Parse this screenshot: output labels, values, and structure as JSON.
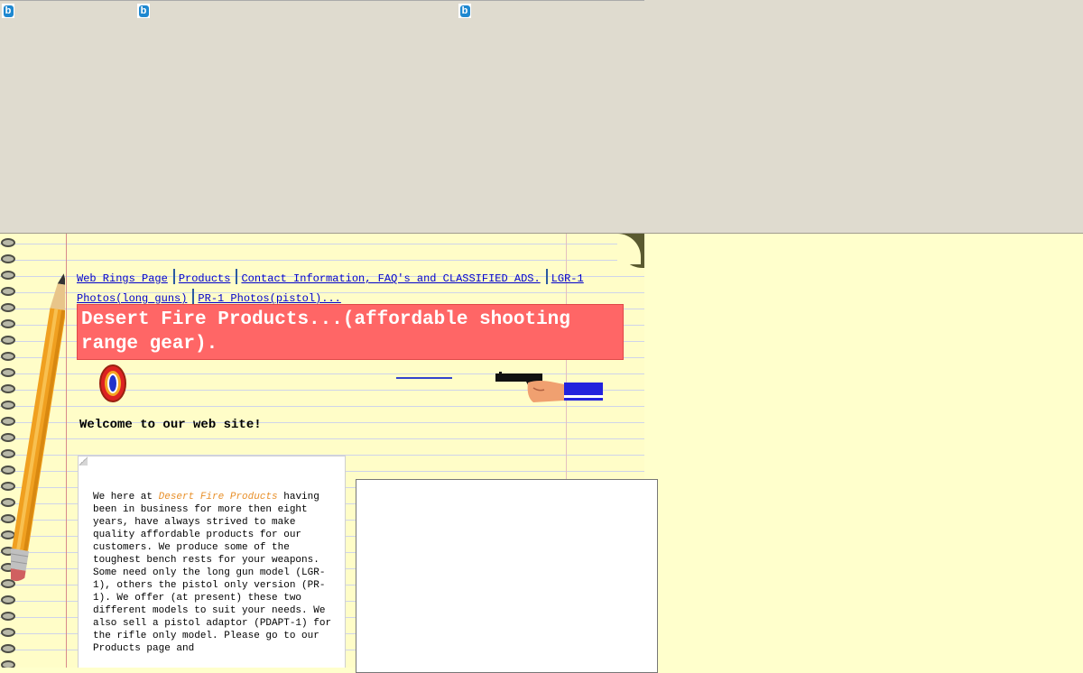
{
  "nav": {
    "links": [
      "Web Rings Page",
      "Products",
      "Contact Information, FAQ's and CLASSIFIED ADS.",
      "LGR-1 Photos(long guns)",
      "PR-1 Photos(pistol)..."
    ]
  },
  "header": {
    "title": "Desert Fire Products...(affordable shooting range gear)."
  },
  "welcome": "Welcome to our web site!",
  "intro": {
    "lead": "We here at ",
    "company": "Desert Fire Products",
    "text": " having been in business for more then eight years, have always strived to make quality affordable products for our customers. We produce some of the toughest bench rests for your weapons. Some need only the long gun model (LGR-1), others the pistol only version (PR-1). We offer (at present) these two different models to suit your needs. We also sell a pistol adaptor (PDAPT-1) for the rifle only model. Please go to our Products page and"
  },
  "icons": {
    "browser_icon": "b",
    "colors": {
      "title_bg": "#ff6666",
      "company_text": "#e8902a",
      "link": "#0000cc"
    }
  }
}
